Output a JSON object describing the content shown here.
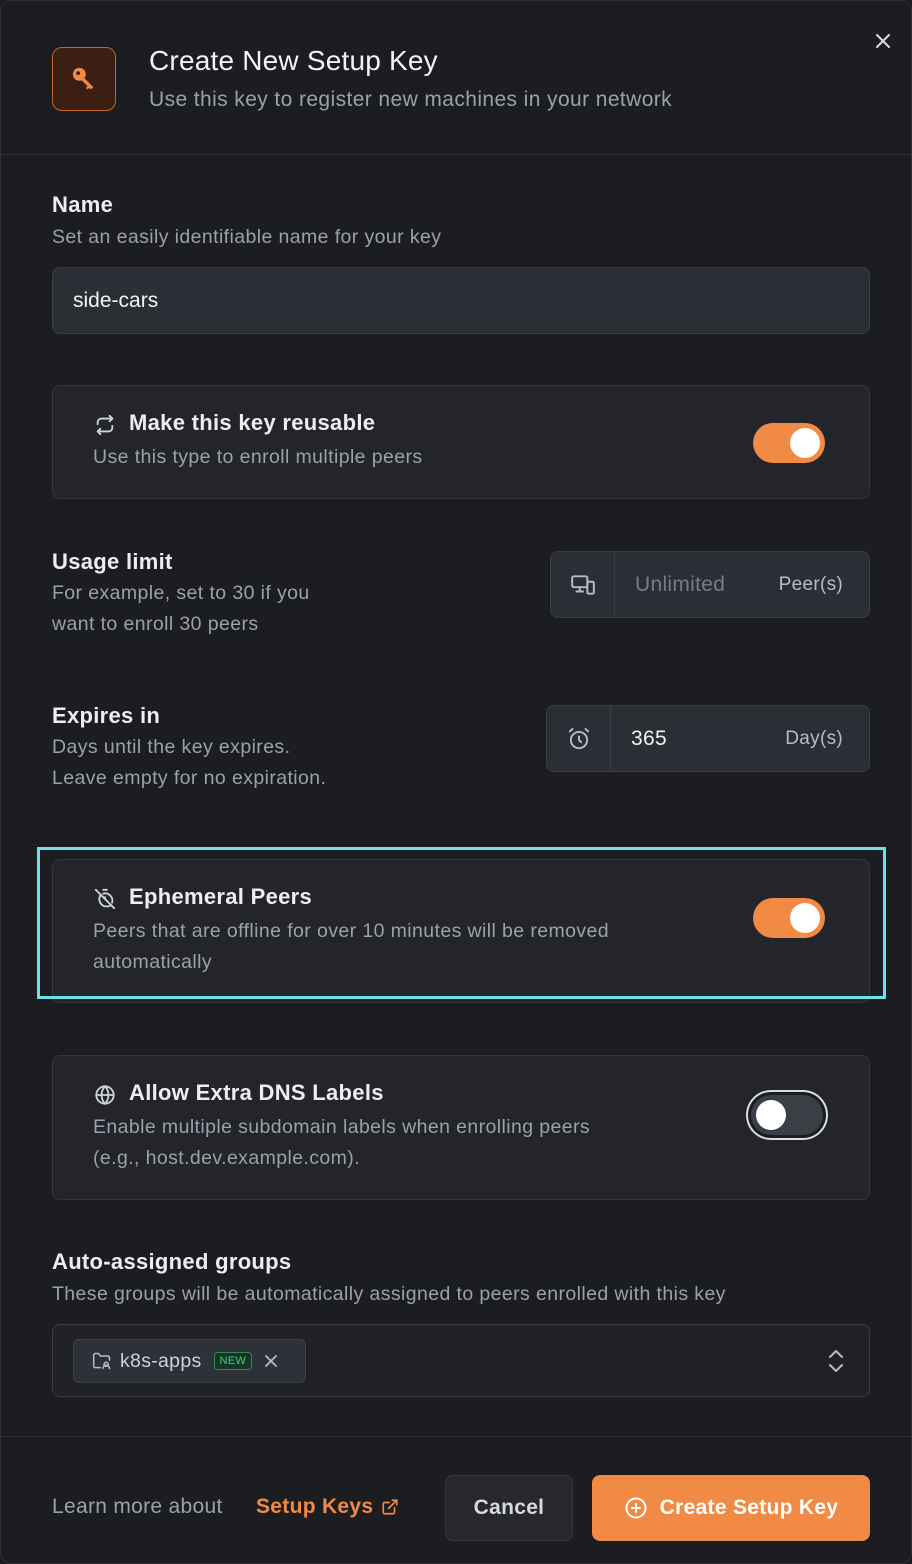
{
  "header": {
    "title": "Create New Setup Key",
    "subtitle": "Use this key to register new machines in your network"
  },
  "name_section": {
    "title": "Name",
    "description": "Set an easily identifiable name for your key",
    "value": "side-cars"
  },
  "reusable": {
    "title": "Make this key reusable",
    "description": "Use this type to enroll multiple peers",
    "enabled": true
  },
  "usage_limit": {
    "title": "Usage limit",
    "description_line1": "For example, set to 30 if you",
    "description_line2": "want to enroll 30 peers",
    "placeholder": "Unlimited",
    "unit": "Peer(s)"
  },
  "expires": {
    "title": "Expires in",
    "description_line1": "Days until the key expires.",
    "description_line2": "Leave empty for no expiration.",
    "value": "365",
    "unit": "Day(s)"
  },
  "ephemeral": {
    "title": "Ephemeral Peers",
    "description_line1": "Peers that are offline for over 10 minutes will be removed",
    "description_line2": "automatically",
    "enabled": true
  },
  "dns_labels": {
    "title": "Allow Extra DNS Labels",
    "description_line1": "Enable multiple subdomain labels when enrolling peers",
    "description_line2": "(e.g., host.dev.example.com).",
    "enabled": false
  },
  "groups": {
    "title": "Auto-assigned groups",
    "description": "These groups will be automatically assigned to peers enrolled with this key",
    "chips": [
      {
        "label": "k8s-apps",
        "badge": "NEW"
      }
    ]
  },
  "footer": {
    "learn_more": "Learn more about",
    "link_label": "Setup Keys",
    "cancel_label": "Cancel",
    "create_label": "Create Setup Key"
  },
  "colors": {
    "accent": "#f08a45",
    "highlight": "#6fe0ea",
    "badge_green": "#3fcf7f"
  },
  "icons": {
    "header": "key-icon",
    "reusable": "repeat-icon",
    "usage": "devices-icon",
    "expires": "alarm-clock-icon",
    "ephemeral": "timer-off-icon",
    "dns": "globe-icon",
    "chip": "folder-group-icon",
    "link": "external-link-icon",
    "create": "plus-circle-icon"
  }
}
